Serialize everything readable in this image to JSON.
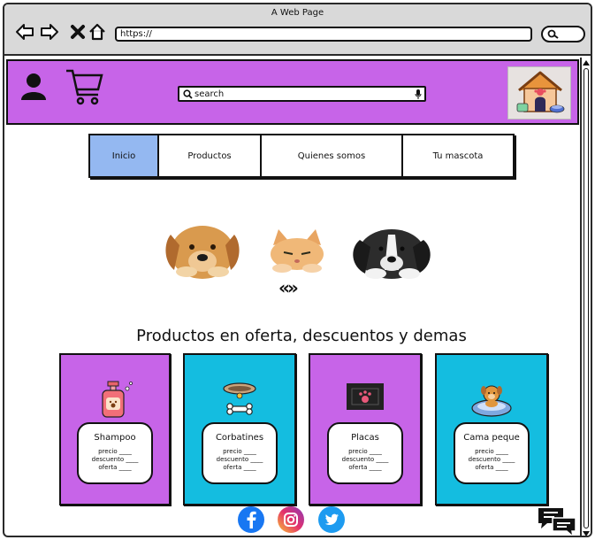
{
  "browser": {
    "window_title": "A Web Page",
    "url": "https://"
  },
  "header": {
    "search_placeholder": "search",
    "icons": [
      "user-icon",
      "cart-icon",
      "mic-icon",
      "pet-house-logo"
    ],
    "background_color": "#c764e8"
  },
  "tabs": [
    {
      "label": "Inicio",
      "active": true
    },
    {
      "label": "Productos",
      "active": false
    },
    {
      "label": "Quienes somos",
      "active": false
    },
    {
      "label": "Tu mascota",
      "active": false
    }
  ],
  "carousel": {
    "controls": "«»"
  },
  "section_title": "Productos en oferta, descuentos y demas",
  "products": [
    {
      "name": "Shampoo",
      "precio": "precio ____",
      "descuento": "descuento ____",
      "oferta": "oferta ____",
      "color": "#c764e8",
      "icon": "shampoo-bottle-icon"
    },
    {
      "name": "Corbatines",
      "precio": "precio ____",
      "descuento": "descuento ____",
      "oferta": "oferta ____",
      "color": "#14bde0",
      "icon": "collar-bone-icon"
    },
    {
      "name": "Placas",
      "precio": "precio ____",
      "descuento": "descuento ____",
      "oferta": "oferta ____",
      "color": "#c764e8",
      "icon": "paw-tag-icon"
    },
    {
      "name": "Cama peque",
      "precio": "precio ____",
      "descuento": "descuento ____",
      "oferta": "oferta ____",
      "color": "#14bde0",
      "icon": "dog-bed-icon"
    }
  ],
  "footer": {
    "social": [
      "facebook-icon",
      "instagram-icon",
      "twitter-icon"
    ],
    "chat": "chat-icon"
  }
}
